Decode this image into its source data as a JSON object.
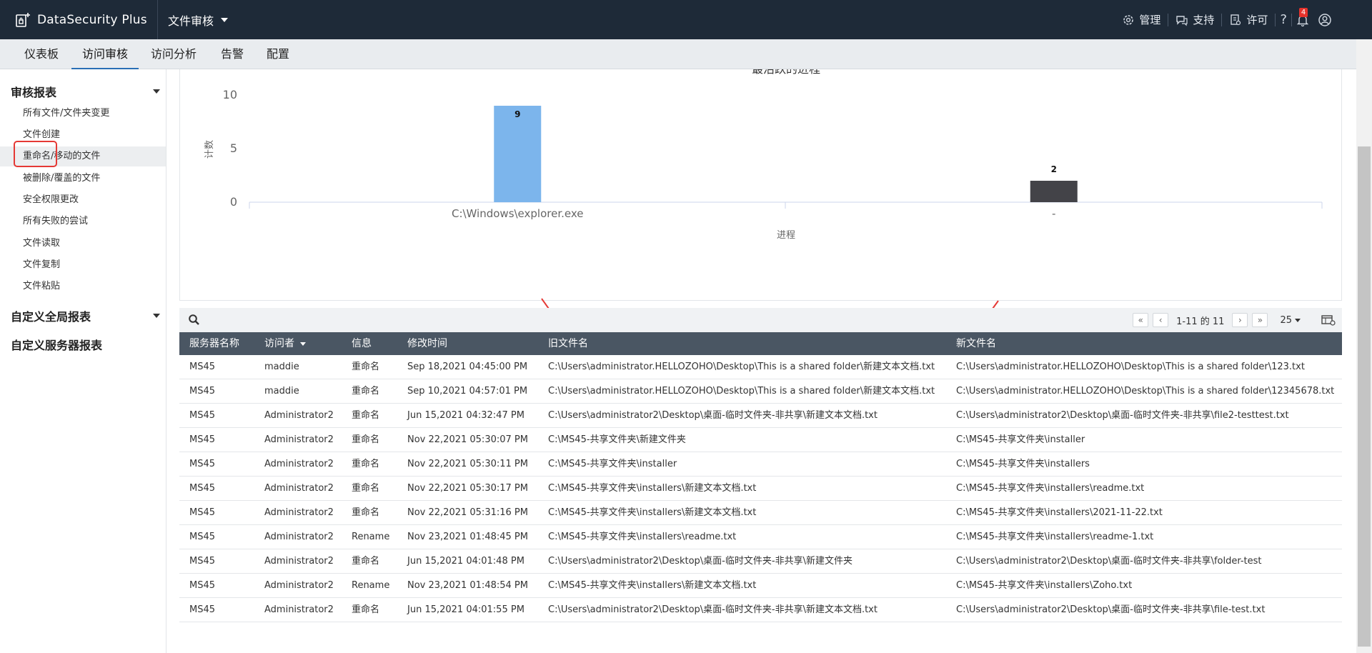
{
  "app": {
    "name": "DataSecurity Plus",
    "module": "文件审核"
  },
  "topbar": {
    "links": [
      {
        "label": "管理",
        "icon": "gear-icon"
      },
      {
        "label": "支持",
        "icon": "support-icon"
      },
      {
        "label": "许可",
        "icon": "license-icon"
      }
    ],
    "help": "?",
    "notification_count": "4"
  },
  "nav": {
    "tabs": [
      "仪表板",
      "访问审核",
      "访问分析",
      "告警",
      "配置"
    ],
    "active": "访问审核"
  },
  "sidebar": {
    "sections": [
      {
        "title": "审核报表",
        "items": [
          "所有文件/文件夹变更",
          "文件创建",
          "重命名/移动的文件",
          "被删除/覆盖的文件",
          "安全权限更改",
          "所有失败的尝试",
          "文件读取",
          "文件复制",
          "文件粘贴"
        ],
        "active": "重命名/移动的文件"
      },
      {
        "title": "自定义全局报表"
      },
      {
        "title": "自定义服务器报表"
      }
    ]
  },
  "chart_data": {
    "type": "bar",
    "title": "最活跃的进程",
    "xlabel": "进程",
    "ylabel": "计数",
    "categories": [
      "C:\\Windows\\explorer.exe",
      "-"
    ],
    "values": [
      9,
      2
    ],
    "colors": [
      "#7cb5ec",
      "#434348"
    ],
    "yticks": [
      0,
      5,
      10
    ],
    "ylim": [
      0,
      10
    ]
  },
  "table": {
    "pagination": {
      "info": "1-11 的 11",
      "page_size": "25"
    },
    "columns": [
      "服务器名称",
      "访问者",
      "信息",
      "修改时间",
      "旧文件名",
      "新文件名"
    ],
    "rows": [
      [
        "MS45",
        "maddie",
        "重命名",
        "Sep 18,2021 04:45:00 PM",
        "C:\\Users\\administrator.HELLOZOHO\\Desktop\\This is a shared folder\\新建文本文档.txt",
        "C:\\Users\\administrator.HELLOZOHO\\Desktop\\This is a shared folder\\123.txt"
      ],
      [
        "MS45",
        "maddie",
        "重命名",
        "Sep 10,2021 04:57:01 PM",
        "C:\\Users\\administrator.HELLOZOHO\\Desktop\\This is a shared folder\\新建文本文档.txt",
        "C:\\Users\\administrator.HELLOZOHO\\Desktop\\This is a shared folder\\12345678.txt"
      ],
      [
        "MS45",
        "Administrator2",
        "重命名",
        "Jun 15,2021 04:32:47 PM",
        "C:\\Users\\administrator2\\Desktop\\桌面-临时文件夹-非共享\\新建文本文档.txt",
        "C:\\Users\\administrator2\\Desktop\\桌面-临时文件夹-非共享\\file2-testtest.txt"
      ],
      [
        "MS45",
        "Administrator2",
        "重命名",
        "Nov 22,2021 05:30:07 PM",
        "C:\\MS45-共享文件夹\\新建文件夹",
        "C:\\MS45-共享文件夹\\installer"
      ],
      [
        "MS45",
        "Administrator2",
        "重命名",
        "Nov 22,2021 05:30:11 PM",
        "C:\\MS45-共享文件夹\\installer",
        "C:\\MS45-共享文件夹\\installers"
      ],
      [
        "MS45",
        "Administrator2",
        "重命名",
        "Nov 22,2021 05:30:17 PM",
        "C:\\MS45-共享文件夹\\installers\\新建文本文档.txt",
        "C:\\MS45-共享文件夹\\installers\\readme.txt"
      ],
      [
        "MS45",
        "Administrator2",
        "重命名",
        "Nov 22,2021 05:31:16 PM",
        "C:\\MS45-共享文件夹\\installers\\新建文本文档.txt",
        "C:\\MS45-共享文件夹\\installers\\2021-11-22.txt"
      ],
      [
        "MS45",
        "Administrator2",
        "Rename",
        "Nov 23,2021 01:48:45 PM",
        "C:\\MS45-共享文件夹\\installers\\readme.txt",
        "C:\\MS45-共享文件夹\\installers\\readme-1.txt"
      ],
      [
        "MS45",
        "Administrator2",
        "重命名",
        "Jun 15,2021 04:01:48 PM",
        "C:\\Users\\administrator2\\Desktop\\桌面-临时文件夹-非共享\\新建文件夹",
        "C:\\Users\\administrator2\\Desktop\\桌面-临时文件夹-非共享\\folder-test"
      ],
      [
        "MS45",
        "Administrator2",
        "Rename",
        "Nov 23,2021 01:48:54 PM",
        "C:\\MS45-共享文件夹\\installers\\新建文本文档.txt",
        "C:\\MS45-共享文件夹\\installers\\Zoho.txt"
      ],
      [
        "MS45",
        "Administrator2",
        "重命名",
        "Jun 15,2021 04:01:55 PM",
        "C:\\Users\\administrator2\\Desktop\\桌面-临时文件夹-非共享\\新建文本文档.txt",
        "C:\\Users\\administrator2\\Desktop\\桌面-临时文件夹-非共享\\file-test.txt"
      ]
    ]
  },
  "colors": {
    "topbar": "#1e2a38",
    "table_header": "#4a5663",
    "accent": "#2a6fb5",
    "annotation": "#e53935"
  }
}
